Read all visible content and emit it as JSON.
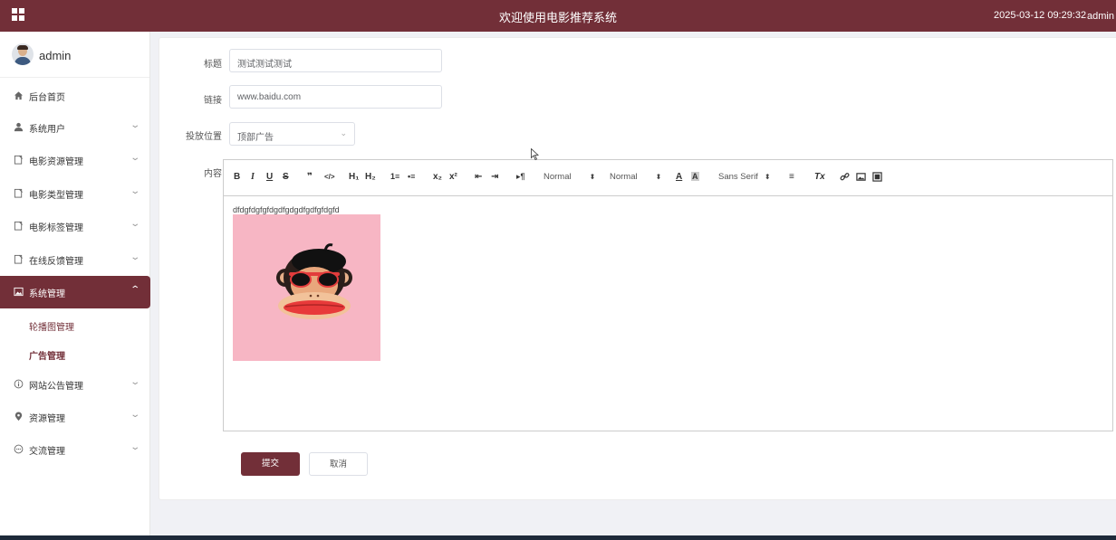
{
  "header": {
    "title": "欢迎使用电影推荐系统",
    "datetime": "2025-03-12 09:29:32",
    "user": "admin",
    "user_caret": "⌄"
  },
  "sidebar": {
    "profile_name": "admin",
    "items": [
      {
        "label": "后台首页",
        "icon": "home-icon"
      },
      {
        "label": "系统用户",
        "icon": "user-icon"
      },
      {
        "label": "电影资源管理",
        "icon": "document-icon"
      },
      {
        "label": "电影类型管理",
        "icon": "document-icon"
      },
      {
        "label": "电影标签管理",
        "icon": "document-icon"
      },
      {
        "label": "在线反馈管理",
        "icon": "document-icon"
      },
      {
        "label": "系统管理",
        "icon": "picture-icon"
      },
      {
        "label": "网站公告管理",
        "icon": "info-icon"
      },
      {
        "label": "资源管理",
        "icon": "location-icon"
      },
      {
        "label": "交流管理",
        "icon": "chat-icon"
      }
    ],
    "sub_items": [
      "轮播图管理",
      "广告管理"
    ]
  },
  "form": {
    "title_label": "标题",
    "title_value": "测试测试测试",
    "link_label": "链接",
    "link_value": "www.baidu.com",
    "position_label": "投放位置",
    "position_value": "顶部广告",
    "content_label": "内容"
  },
  "editor": {
    "toolbar": {
      "bold": "B",
      "italic": "I",
      "underline": "U",
      "strike": "S",
      "blockquote": "❞",
      "code": "</>",
      "h1": "H₁",
      "h2": "H₂",
      "ordered_list": "1≡",
      "bullet_list": "•≡",
      "subscript": "x₂",
      "superscript": "x²",
      "outdent": "⇤",
      "indent": "⇥",
      "direction": "▸¶",
      "size_picker": "Normal",
      "header_picker": "Normal",
      "color": "A",
      "background": "A",
      "font_picker": "Sans Serif",
      "align": "≡",
      "clean": "Tx",
      "link": "🔗",
      "image": "▣",
      "video": "▤"
    },
    "content_text": "dfdgfdgfgfdgdfgdgdfgdfgfdgfd",
    "image_alt": "monkey-with-sunglasses-image"
  },
  "actions": {
    "submit": "提交",
    "cancel": "取消"
  },
  "colors": {
    "brand": "#722f38",
    "image_bg": "#f7b6c4"
  }
}
